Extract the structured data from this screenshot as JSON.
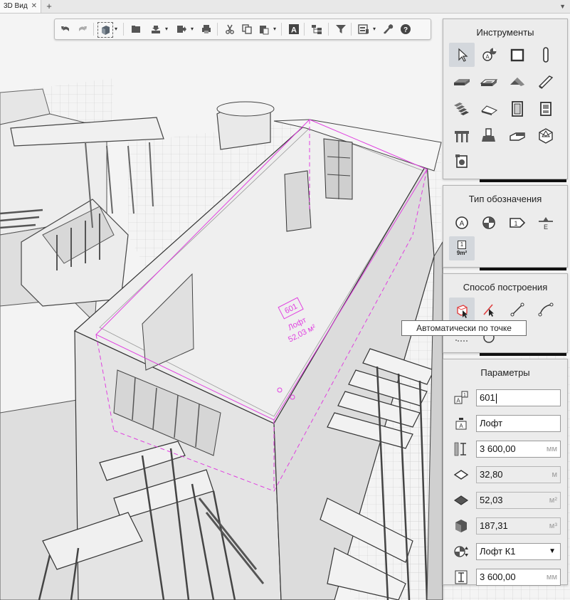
{
  "tab": {
    "title": "3D Вид",
    "close": "✕",
    "add": "+",
    "menu": "▼"
  },
  "panels": {
    "tools": {
      "title": "Инструменты"
    },
    "marker_type": {
      "title": "Тип обозначения",
      "sel_number": "1",
      "sel_area": "9m²"
    },
    "build_method": {
      "title": "Способ построения",
      "tooltip": "Автоматически по точке"
    },
    "params": {
      "title": "Параметры",
      "fields": {
        "number": "601",
        "name": "Лофт",
        "height": "3 600,00",
        "height_unit": "мм",
        "perimeter": "32,80",
        "perimeter_unit": "м",
        "area": "52,03",
        "area_unit": "м²",
        "volume": "187,31",
        "volume_unit": "м³",
        "style": "Лофт К1",
        "offset": "3 600,00",
        "offset_unit": "мм"
      }
    }
  },
  "scene": {
    "room_number": "601",
    "room_name": "Лофт",
    "room_area": "52,03 м²",
    "accent": "#e040e0"
  }
}
